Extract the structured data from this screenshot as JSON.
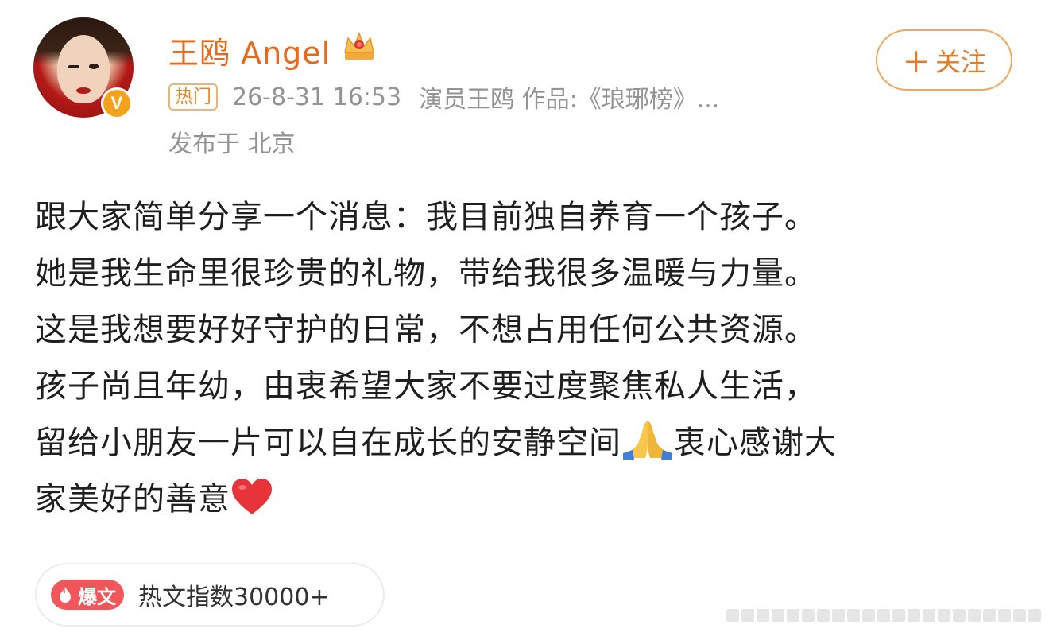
{
  "post": {
    "username": "王鸥 Angel",
    "avatar_badge": "V",
    "hot_tag": "热门",
    "timestamp": "26-8-31 16:53",
    "source": "演员王鸥 作品:《琅琊榜》...",
    "location": "发布于 北京",
    "follow_label": "关注",
    "content_lines": [
      "跟大家简单分享一个消息：我目前独自养育一个孩子。",
      "她是我生命里很珍贵的礼物，带给我很多温暖与力量。",
      "这是我想要好好守护的日常，不想占用任何公共资源。",
      "孩子尚且年幼，由衷希望大家不要过度聚焦私人生活，",
      "留给小朋友一片可以自在成长的安静空间",
      "衷心感谢大",
      "家美好的善意"
    ]
  },
  "hot_index": {
    "badge_label": "爆文",
    "text": "热文指数30000+"
  },
  "colors": {
    "username": "#e8681c",
    "follow_border": "#f0a65e",
    "hot_badge": "#f1565b",
    "meta_text": "#939393"
  },
  "icons": {
    "crown": "crown-icon",
    "verified": "verified-v-icon",
    "pray": "folded-hands-emoji",
    "heart": "red-heart-emoji",
    "flame": "flame-icon"
  }
}
